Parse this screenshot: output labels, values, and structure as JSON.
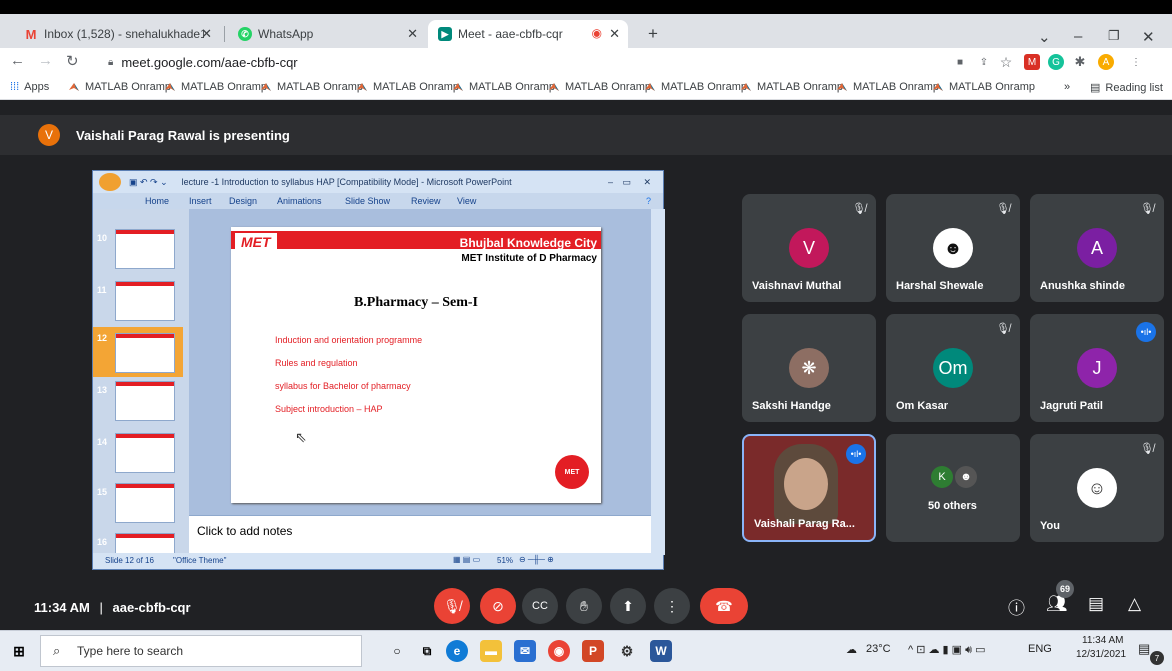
{
  "browser": {
    "tabs": [
      {
        "title": "Inbox (1,528) - snehalukhade199",
        "icon": "gmail-icon",
        "color": "#ea4335",
        "active": false
      },
      {
        "title": "WhatsApp",
        "icon": "whatsapp-icon",
        "color": "#25d366",
        "active": false
      },
      {
        "title": "Meet - aae-cbfb-cqr",
        "icon": "meet-icon",
        "color": "#00897b",
        "active": true
      }
    ],
    "new_tab_label": "+",
    "url": "meet.google.com/aae-cbfb-cqr",
    "apps_label": "Apps",
    "bookmarks": [
      "MATLAB Onramp",
      "MATLAB Onramp",
      "MATLAB Onramp",
      "MATLAB Onramp",
      "MATLAB Onramp",
      "MATLAB Onramp",
      "MATLAB Onramp",
      "MATLAB Onramp",
      "MATLAB Onramp",
      "MATLAB Onramp"
    ],
    "reading_list_label": "Reading list",
    "more_bookmarks": "»"
  },
  "meet": {
    "presenter_initial": "V",
    "presenting_text": "Vaishali Parag Rawal is presenting",
    "time": "11:34 AM",
    "separator": "|",
    "meeting_code": "aae-cbfb-cqr",
    "participant_count": "69",
    "participants": [
      {
        "name": "Vaishnavi Muthal",
        "initial": "V",
        "color": "#c2185b",
        "muted": true
      },
      {
        "name": "Harshal Shewale",
        "initial": "",
        "color": "#ffffff",
        "muted": true
      },
      {
        "name": "Anushka shinde",
        "initial": "A",
        "color": "#7b1fa2",
        "muted": true
      },
      {
        "name": "Sakshi Handge",
        "initial": "",
        "color": "#8d6e63",
        "muted": false
      },
      {
        "name": "Om Kasar",
        "initial": "Om",
        "color": "#00897b",
        "muted": true
      },
      {
        "name": "Jagruti Patil",
        "initial": "J",
        "color": "#8e24aa",
        "muted": false
      },
      {
        "name": "Vaishali Parag Ra...",
        "initial": "",
        "color": "#b71c1c",
        "muted": false
      },
      {
        "name": "50 others",
        "initial": "K",
        "color": "#2e7d32",
        "muted": false
      },
      {
        "name": "You",
        "initial": "",
        "color": "#ffffff",
        "muted": true
      }
    ]
  },
  "powerpoint": {
    "title": "lecture -1 Introduction to syllabus  HAP [Compatibility Mode] - Microsoft PowerPoint",
    "ribbon_tabs": [
      "Home",
      "Insert",
      "Design",
      "Animations",
      "Slide Show",
      "Review",
      "View"
    ],
    "thumb_numbers": [
      "10",
      "11",
      "12",
      "13",
      "14",
      "15",
      "16"
    ],
    "slide": {
      "logo": "MET",
      "header_right": "Bhujbal Knowledge City",
      "institute": "MET Institute of D Pharmacy",
      "title": "B.Pharmacy – Sem-I",
      "bullets": [
        "Induction and orientation programme",
        "Rules and regulation",
        "syllabus for Bachelor of pharmacy",
        "Subject introduction – HAP"
      ],
      "seal": "MET"
    },
    "notes_placeholder": "Click to add notes",
    "status_slide": "Slide 12 of 16",
    "status_theme": "\"Office Theme\"",
    "zoom": "51%"
  },
  "taskbar": {
    "search_placeholder": "Type here to search",
    "weather": "23°C",
    "lang": "ENG",
    "time": "11:34 AM",
    "date": "12/31/2021",
    "notif_count": "7"
  }
}
